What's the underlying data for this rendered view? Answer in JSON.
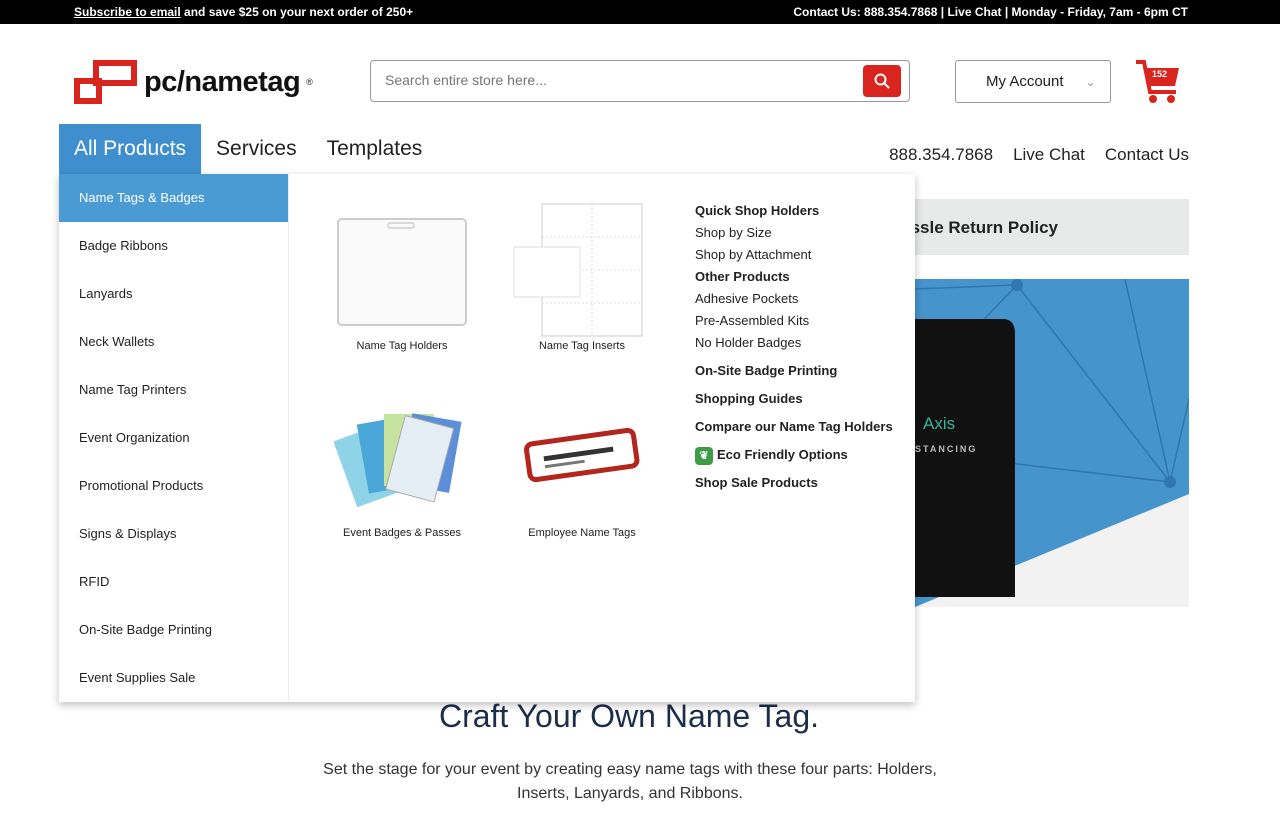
{
  "topbar": {
    "subscribe_link": "Subscribe to email",
    "promo": " and save $25 on your next order of 250+",
    "contact": "Contact Us:  888.354.7868  |  Live Chat  |  Monday - Friday, 7am - 6pm CT"
  },
  "header": {
    "logo": "pc/nametag",
    "search_placeholder": "Search entire store here...",
    "account_label": "My Account",
    "cart_count": "152"
  },
  "nav": {
    "items": [
      "All Products",
      "Services",
      "Templates"
    ],
    "right": [
      "888.354.7868",
      "Live Chat",
      "Contact Us"
    ]
  },
  "menu": {
    "sidebar": [
      "Name Tags & Badges",
      "Badge Ribbons",
      "Lanyards",
      "Neck Wallets",
      "Name Tag Printers",
      "Event Organization",
      "Promotional Products",
      "Signs & Displays",
      "RFID",
      "On-Site Badge Printing",
      "Event Supplies Sale"
    ],
    "products": [
      "Name Tag Holders",
      "Name Tag Inserts",
      "Event Badges & Passes",
      "Employee Name Tags"
    ],
    "links": [
      {
        "t": "Quick Shop Holders",
        "b": true
      },
      {
        "t": "Shop by Size"
      },
      {
        "t": "Shop by Attachment"
      },
      {
        "t": "Other Products",
        "b": true
      },
      {
        "t": "Adhesive Pockets"
      },
      {
        "t": "Pre-Assembled Kits"
      },
      {
        "t": "No Holder Badges"
      },
      {
        "t": "On-Site Badge Printing",
        "b": true
      },
      {
        "t": "Shopping Guides",
        "b": true
      },
      {
        "t": "Compare our Name Tag Holders",
        "b": true
      },
      {
        "t": "Eco Friendly Options",
        "b": true,
        "icon": "leaf-icon"
      },
      {
        "t": "Shop Sale Products",
        "b": true
      }
    ]
  },
  "banner": {
    "text": "No Hassle Return Policy"
  },
  "hero": {
    "product_text": "Axis",
    "sub": "STANCING"
  },
  "main": {
    "heading": "Craft Your Own Name Tag.",
    "body": "Set the stage for your event by creating easy name tags with these four parts: Holders, Inserts, Lanyards, and Ribbons."
  },
  "colors": {
    "brand_red": "#d9251d",
    "accent_blue": "#4a9bd4",
    "heading": "#1d2e4b"
  }
}
